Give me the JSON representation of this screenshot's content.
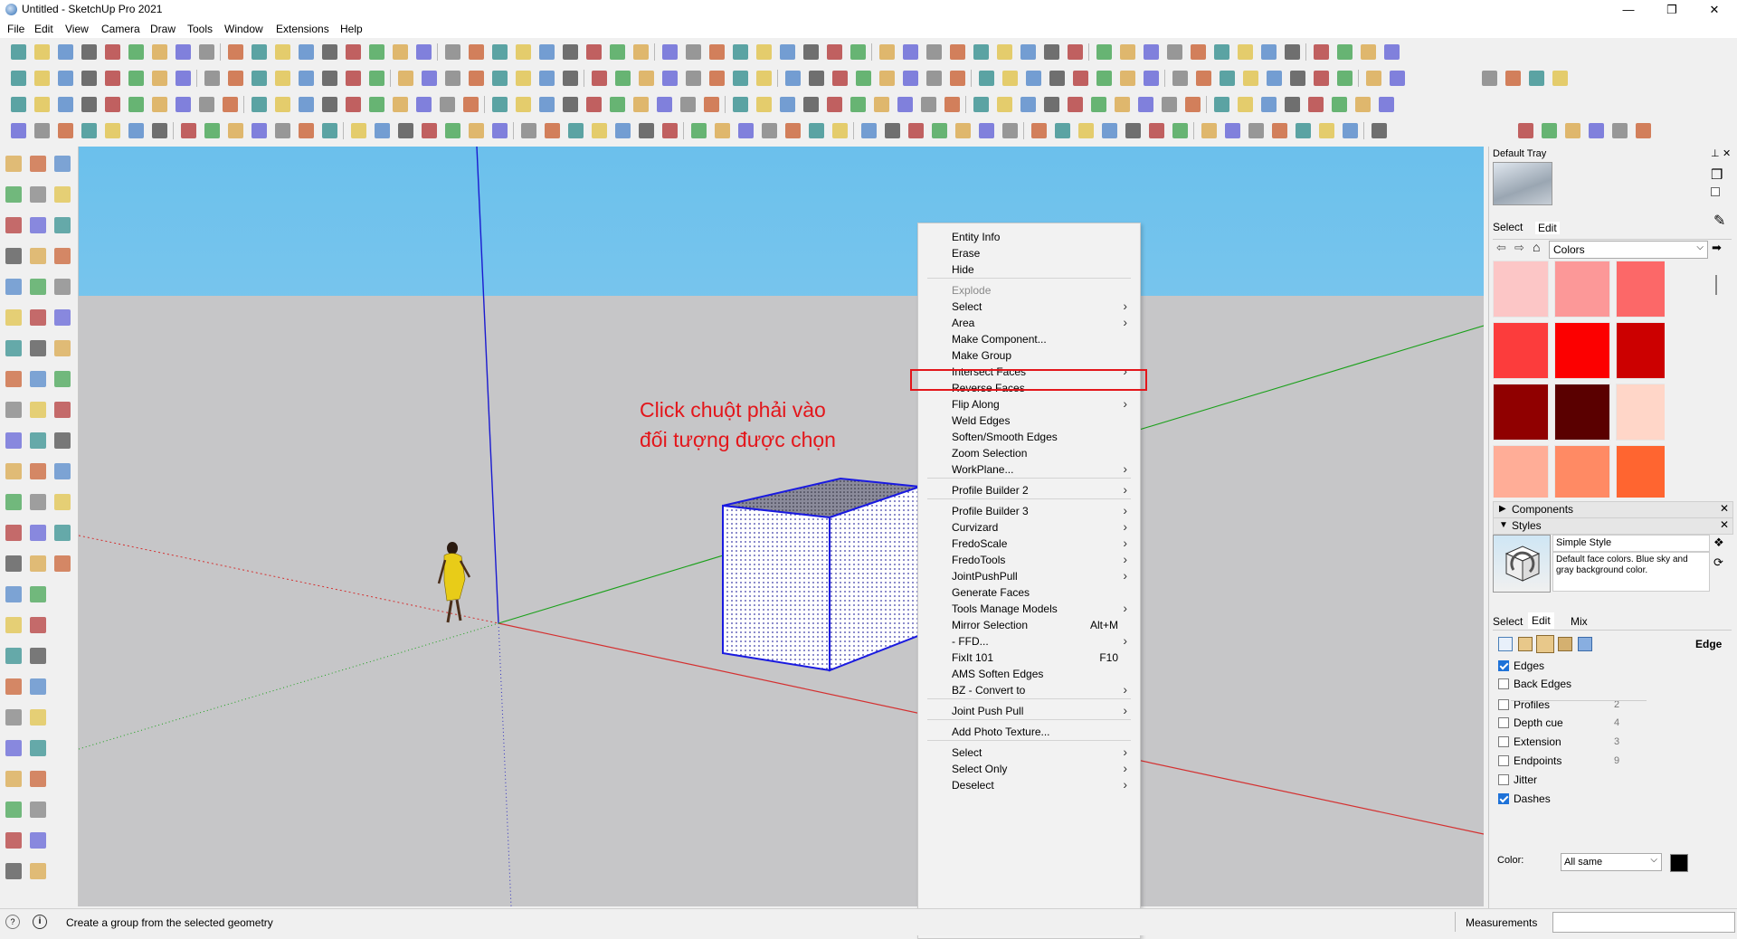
{
  "window": {
    "title": "Untitled - SketchUp Pro 2021",
    "minimize_icon": "minimize-icon",
    "maximize_icon": "maximize-icon",
    "close_icon": "close-icon"
  },
  "menubar": {
    "items": [
      "File",
      "Edit",
      "View",
      "Camera",
      "Draw",
      "Tools",
      "Window",
      "Extensions",
      "Help"
    ]
  },
  "viewport": {
    "annotation_line1": "Click chuột phải vào",
    "annotation_line2": "đối tượng được chọn",
    "colors": {
      "sky": "#6bc0ec",
      "ground": "#c6c6c8",
      "annotation": "#e3161b",
      "selection": "#1a1ae0"
    }
  },
  "context_menu": {
    "items": [
      {
        "label": "Entity Info"
      },
      {
        "label": "Erase"
      },
      {
        "label": "Hide"
      },
      {
        "separator": true
      },
      {
        "label": "Explode",
        "disabled": true
      },
      {
        "label": "Select",
        "submenu": true
      },
      {
        "label": "Area",
        "submenu": true
      },
      {
        "label": "Make Component..."
      },
      {
        "label": "Make Group",
        "highlighted": true
      },
      {
        "label": "Intersect Faces",
        "submenu": true
      },
      {
        "label": "Reverse Faces"
      },
      {
        "label": "Flip Along",
        "submenu": true
      },
      {
        "label": "Weld Edges"
      },
      {
        "label": "Soften/Smooth Edges"
      },
      {
        "label": "Zoom Selection"
      },
      {
        "label": "WorkPlane...",
        "submenu": true
      },
      {
        "separator": true
      },
      {
        "label": "Profile Builder 2",
        "submenu": true
      },
      {
        "separator": true
      },
      {
        "label": "Profile Builder 3",
        "submenu": true
      },
      {
        "label": "Curvizard",
        "submenu": true
      },
      {
        "label": "FredoScale",
        "submenu": true
      },
      {
        "label": "FredoTools",
        "submenu": true
      },
      {
        "label": "JointPushPull",
        "submenu": true
      },
      {
        "label": "Generate Faces"
      },
      {
        "label": "Tools Manage Models",
        "submenu": true
      },
      {
        "label": "Mirror Selection",
        "shortcut": "Alt+M"
      },
      {
        "label": "- FFD...",
        "submenu": true
      },
      {
        "label": "FixIt 101",
        "shortcut": "F10"
      },
      {
        "label": "AMS Soften Edges"
      },
      {
        "label": "BZ - Convert to",
        "submenu": true
      },
      {
        "separator": true
      },
      {
        "label": "Joint Push Pull",
        "submenu": true
      },
      {
        "separator": true
      },
      {
        "label": "Add Photo Texture..."
      },
      {
        "separator": true
      },
      {
        "label": "Select",
        "submenu": true
      },
      {
        "label": "Select Only",
        "submenu": true
      },
      {
        "label": "Deselect",
        "submenu": true
      }
    ]
  },
  "tray": {
    "title": "Default Tray",
    "materials": {
      "tabs": [
        "Select",
        "Edit"
      ],
      "library": "Colors",
      "swatches": [
        "#fcc6c6",
        "#fc9898",
        "#fc6868",
        "#fc3c3c",
        "#fc0000",
        "#cc0000",
        "#900000",
        "#5a0000",
        "#ffd6c8",
        "#ffad97",
        "#ff8a64",
        "#ff6530"
      ]
    },
    "components_label": "Components",
    "styles": {
      "label": "Styles",
      "style_name": "Simple Style",
      "style_desc": "Default face colors. Blue sky and gray background color.",
      "tabs": [
        "Select",
        "Edit",
        "Mix"
      ],
      "section": "Edge",
      "options": [
        {
          "label": "Edges",
          "checked": true,
          "value": ""
        },
        {
          "label": "Back Edges",
          "checked": false,
          "value": ""
        },
        {
          "label": "Profiles",
          "checked": false,
          "value": "2"
        },
        {
          "label": "Depth cue",
          "checked": false,
          "value": "4"
        },
        {
          "label": "Extension",
          "checked": false,
          "value": "3"
        },
        {
          "label": "Endpoints",
          "checked": false,
          "value": "9"
        },
        {
          "label": "Jitter",
          "checked": false,
          "value": ""
        },
        {
          "label": "Dashes",
          "checked": true,
          "value": ""
        }
      ],
      "color_label": "Color:",
      "color_value": "All same",
      "color_swatch": "#000000"
    }
  },
  "statusbar": {
    "message": "Create a group from the selected geometry",
    "measurements_label": "Measurements",
    "measurements_value": ""
  }
}
